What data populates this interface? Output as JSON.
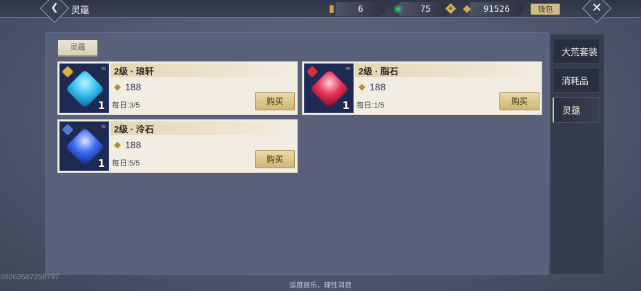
{
  "header": {
    "title": "灵蕴",
    "currencies": [
      {
        "icon": "gold-ticket-icon",
        "value": "6"
      },
      {
        "icon": "jade-coin-icon",
        "value": "75"
      },
      {
        "icon": "gold-ingot-icon",
        "value": "91526"
      }
    ],
    "wallet_label": "钱包"
  },
  "tabs": {
    "active": "灵蕴"
  },
  "items": [
    {
      "name": "2级 · 琅轩",
      "price": "188",
      "daily": "每日:3/5",
      "qty": "1",
      "buy": "购买",
      "gem_color": "#3ac4f0",
      "rarity_color": "#d8b23a"
    },
    {
      "name": "2级 · 脂石",
      "price": "188",
      "daily": "每日:1/5",
      "qty": "1",
      "buy": "购买",
      "gem_color": "#e8345a",
      "rarity_color": "#d0333f"
    },
    {
      "name": "2级 · 泠石",
      "price": "188",
      "daily": "每日:5/5",
      "qty": "1",
      "buy": "购买",
      "gem_color": "#3d6cf0",
      "rarity_color": "#4d7fd3"
    }
  ],
  "side_tabs": [
    {
      "label": "大荒套装"
    },
    {
      "label": "消耗品"
    },
    {
      "label": "灵蕴"
    }
  ],
  "footer": {
    "uid": "38263587258797",
    "notice": "适度娱乐，理性消费"
  }
}
